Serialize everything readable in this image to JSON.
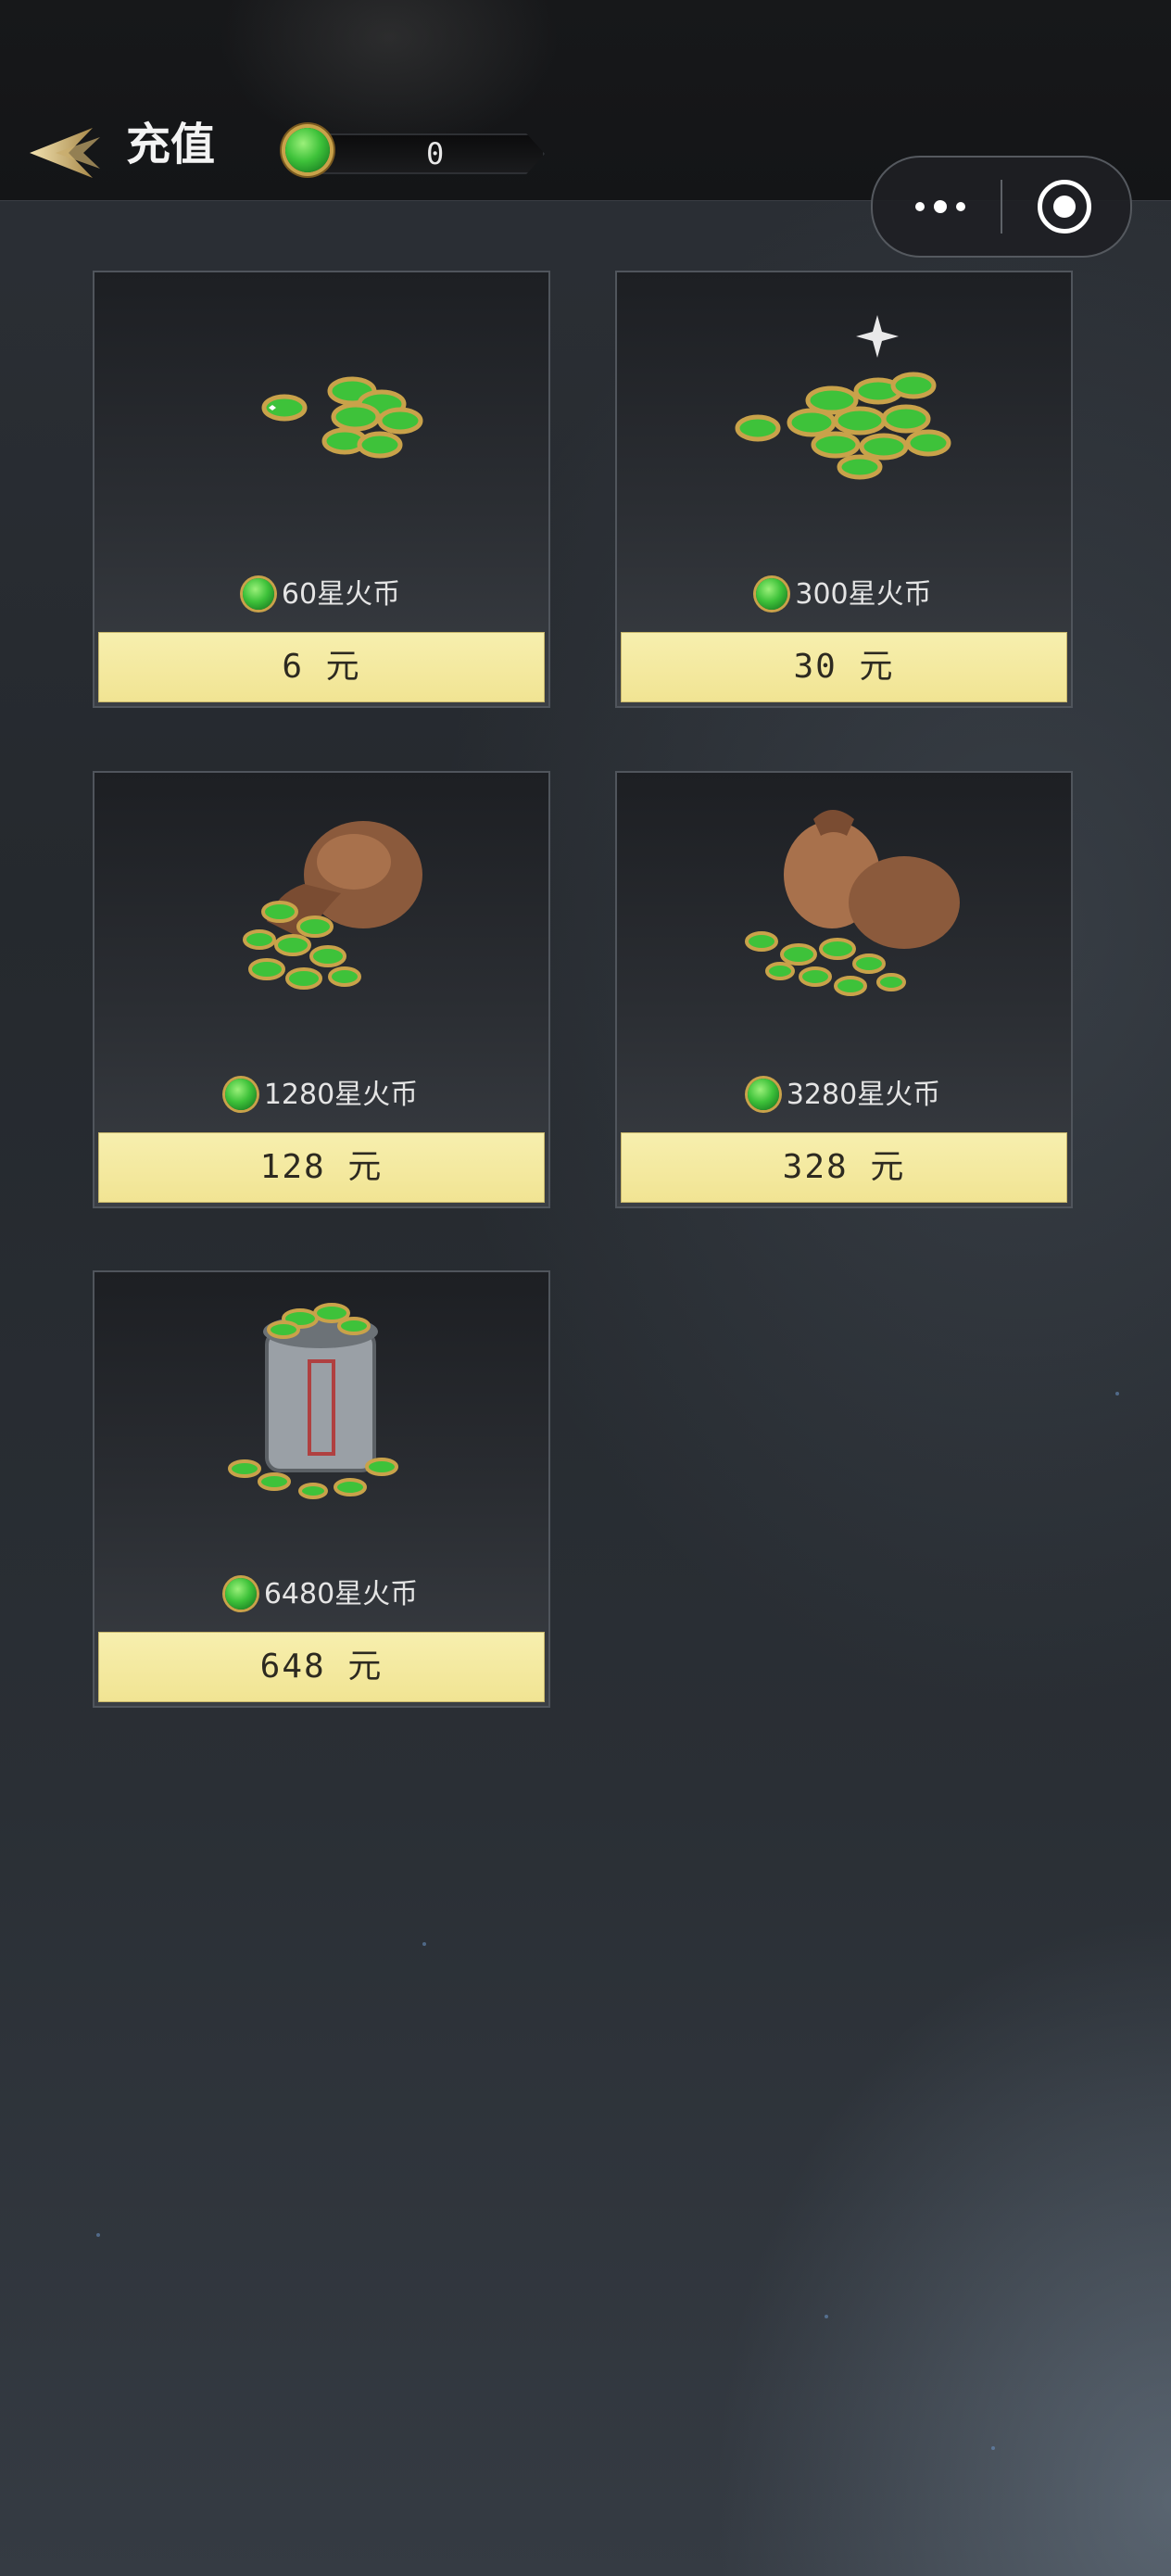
{
  "header": {
    "title": "充值",
    "back_icon": "back-arrow-icon",
    "balance_value": "0",
    "balance_icon": "jade-coin-icon"
  },
  "capsule": {
    "more_icon": "more-dots-icon",
    "close_icon": "miniprogram-close-icon"
  },
  "packages": [
    {
      "coins_label": "60星火币",
      "price_label": "6 元",
      "art": "small-coin-pile"
    },
    {
      "coins_label": "300星火币",
      "price_label": "30 元",
      "art": "medium-coin-pile"
    },
    {
      "coins_label": "1280星火币",
      "price_label": "128 元",
      "art": "coin-bag"
    },
    {
      "coins_label": "3280星火币",
      "price_label": "328 元",
      "art": "two-coin-bags"
    },
    {
      "coins_label": "6480星火币",
      "price_label": "648 元",
      "art": "coin-barrel"
    }
  ],
  "colors": {
    "price_button": "#f3e89c",
    "coin_green": "#3ec23a",
    "coin_rim": "#c9a24a",
    "background": "#2a2f35"
  }
}
